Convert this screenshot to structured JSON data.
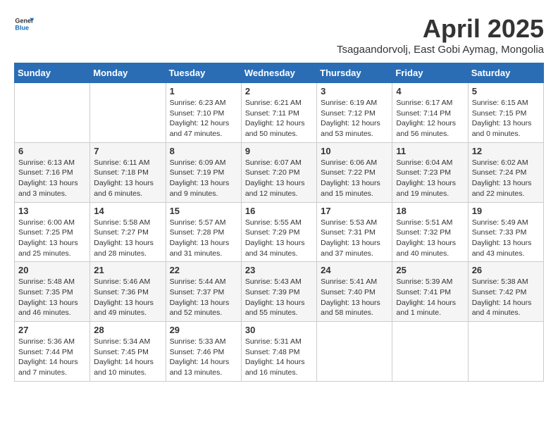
{
  "logo": {
    "general": "General",
    "blue": "Blue"
  },
  "header": {
    "month_year": "April 2025",
    "location": "Tsagaandorvolj, East Gobi Aymag, Mongolia"
  },
  "weekdays": [
    "Sunday",
    "Monday",
    "Tuesday",
    "Wednesday",
    "Thursday",
    "Friday",
    "Saturday"
  ],
  "weeks": [
    [
      {
        "day": "",
        "info": ""
      },
      {
        "day": "",
        "info": ""
      },
      {
        "day": "1",
        "info": "Sunrise: 6:23 AM\nSunset: 7:10 PM\nDaylight: 12 hours and 47 minutes."
      },
      {
        "day": "2",
        "info": "Sunrise: 6:21 AM\nSunset: 7:11 PM\nDaylight: 12 hours and 50 minutes."
      },
      {
        "day": "3",
        "info": "Sunrise: 6:19 AM\nSunset: 7:12 PM\nDaylight: 12 hours and 53 minutes."
      },
      {
        "day": "4",
        "info": "Sunrise: 6:17 AM\nSunset: 7:14 PM\nDaylight: 12 hours and 56 minutes."
      },
      {
        "day": "5",
        "info": "Sunrise: 6:15 AM\nSunset: 7:15 PM\nDaylight: 13 hours and 0 minutes."
      }
    ],
    [
      {
        "day": "6",
        "info": "Sunrise: 6:13 AM\nSunset: 7:16 PM\nDaylight: 13 hours and 3 minutes."
      },
      {
        "day": "7",
        "info": "Sunrise: 6:11 AM\nSunset: 7:18 PM\nDaylight: 13 hours and 6 minutes."
      },
      {
        "day": "8",
        "info": "Sunrise: 6:09 AM\nSunset: 7:19 PM\nDaylight: 13 hours and 9 minutes."
      },
      {
        "day": "9",
        "info": "Sunrise: 6:07 AM\nSunset: 7:20 PM\nDaylight: 13 hours and 12 minutes."
      },
      {
        "day": "10",
        "info": "Sunrise: 6:06 AM\nSunset: 7:22 PM\nDaylight: 13 hours and 15 minutes."
      },
      {
        "day": "11",
        "info": "Sunrise: 6:04 AM\nSunset: 7:23 PM\nDaylight: 13 hours and 19 minutes."
      },
      {
        "day": "12",
        "info": "Sunrise: 6:02 AM\nSunset: 7:24 PM\nDaylight: 13 hours and 22 minutes."
      }
    ],
    [
      {
        "day": "13",
        "info": "Sunrise: 6:00 AM\nSunset: 7:25 PM\nDaylight: 13 hours and 25 minutes."
      },
      {
        "day": "14",
        "info": "Sunrise: 5:58 AM\nSunset: 7:27 PM\nDaylight: 13 hours and 28 minutes."
      },
      {
        "day": "15",
        "info": "Sunrise: 5:57 AM\nSunset: 7:28 PM\nDaylight: 13 hours and 31 minutes."
      },
      {
        "day": "16",
        "info": "Sunrise: 5:55 AM\nSunset: 7:29 PM\nDaylight: 13 hours and 34 minutes."
      },
      {
        "day": "17",
        "info": "Sunrise: 5:53 AM\nSunset: 7:31 PM\nDaylight: 13 hours and 37 minutes."
      },
      {
        "day": "18",
        "info": "Sunrise: 5:51 AM\nSunset: 7:32 PM\nDaylight: 13 hours and 40 minutes."
      },
      {
        "day": "19",
        "info": "Sunrise: 5:49 AM\nSunset: 7:33 PM\nDaylight: 13 hours and 43 minutes."
      }
    ],
    [
      {
        "day": "20",
        "info": "Sunrise: 5:48 AM\nSunset: 7:35 PM\nDaylight: 13 hours and 46 minutes."
      },
      {
        "day": "21",
        "info": "Sunrise: 5:46 AM\nSunset: 7:36 PM\nDaylight: 13 hours and 49 minutes."
      },
      {
        "day": "22",
        "info": "Sunrise: 5:44 AM\nSunset: 7:37 PM\nDaylight: 13 hours and 52 minutes."
      },
      {
        "day": "23",
        "info": "Sunrise: 5:43 AM\nSunset: 7:39 PM\nDaylight: 13 hours and 55 minutes."
      },
      {
        "day": "24",
        "info": "Sunrise: 5:41 AM\nSunset: 7:40 PM\nDaylight: 13 hours and 58 minutes."
      },
      {
        "day": "25",
        "info": "Sunrise: 5:39 AM\nSunset: 7:41 PM\nDaylight: 14 hours and 1 minute."
      },
      {
        "day": "26",
        "info": "Sunrise: 5:38 AM\nSunset: 7:42 PM\nDaylight: 14 hours and 4 minutes."
      }
    ],
    [
      {
        "day": "27",
        "info": "Sunrise: 5:36 AM\nSunset: 7:44 PM\nDaylight: 14 hours and 7 minutes."
      },
      {
        "day": "28",
        "info": "Sunrise: 5:34 AM\nSunset: 7:45 PM\nDaylight: 14 hours and 10 minutes."
      },
      {
        "day": "29",
        "info": "Sunrise: 5:33 AM\nSunset: 7:46 PM\nDaylight: 14 hours and 13 minutes."
      },
      {
        "day": "30",
        "info": "Sunrise: 5:31 AM\nSunset: 7:48 PM\nDaylight: 14 hours and 16 minutes."
      },
      {
        "day": "",
        "info": ""
      },
      {
        "day": "",
        "info": ""
      },
      {
        "day": "",
        "info": ""
      }
    ]
  ]
}
